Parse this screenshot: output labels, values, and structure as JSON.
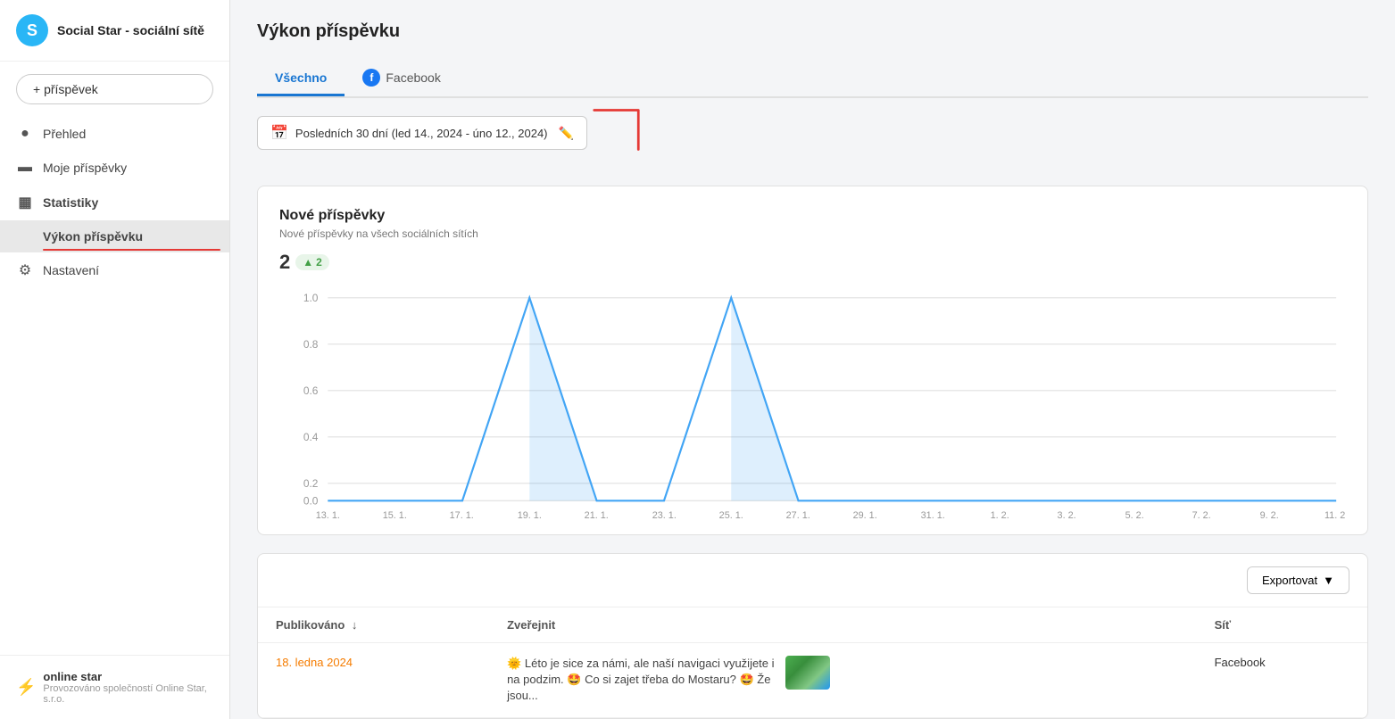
{
  "sidebar": {
    "logo_letter": "S",
    "title": "Social Star - sociální sítě",
    "add_post_label": "+ příspěvek",
    "nav_items": [
      {
        "id": "prehled",
        "label": "Přehled",
        "icon": "●"
      },
      {
        "id": "moje-prispevky",
        "label": "Moje příspěvky",
        "icon": "▬"
      },
      {
        "id": "statistiky",
        "label": "Statistiky",
        "icon": "▦",
        "expanded": true
      },
      {
        "id": "vykon-prispevku",
        "label": "Výkon příspěvku",
        "sub": true
      },
      {
        "id": "nastaveni",
        "label": "Nastavení",
        "icon": "⚙"
      }
    ],
    "footer": {
      "brand_icon": "⚡",
      "brand_name": "online star",
      "powered_by": "Provozováno společností Online Star, s.r.o."
    }
  },
  "page": {
    "title": "Výkon příspěvku",
    "tabs": [
      {
        "id": "vsechno",
        "label": "Všechno",
        "active": true
      },
      {
        "id": "facebook",
        "label": "Facebook",
        "active": false,
        "has_icon": true
      }
    ],
    "date_filter": {
      "label": "Posledních 30 dní (led 14., 2024 - úno 12., 2024)"
    },
    "chart": {
      "title": "Nové příspěvky",
      "subtitle": "Nové příspěvky na všech sociálních sítích",
      "stat_value": "2",
      "stat_badge": "▲ 2",
      "x_labels": [
        "13. 1.",
        "15. 1.",
        "17. 1.",
        "19. 1.",
        "21. 1.",
        "23. 1.",
        "25. 1.",
        "27. 1.",
        "29. 1.",
        "31. 1.",
        "1. 2.",
        "3. 2.",
        "5. 2.",
        "7. 2.",
        "9. 2.",
        "11. 2."
      ],
      "y_labels": [
        "0.0",
        "0.2",
        "0.4",
        "0.6",
        "0.8",
        "1.0"
      ],
      "peaks": [
        {
          "x_index": 3,
          "value": 1.0
        },
        {
          "x_index": 6,
          "value": 1.0
        }
      ]
    },
    "table": {
      "export_label": "Exportovat",
      "columns": [
        "Publikováno",
        "Zveřejnit",
        "Síť"
      ],
      "rows": [
        {
          "date": "18. ledna 2024",
          "text": "🌞 Léto je sice za námi, ale naší navigaci využijete i na podzim. 🤩 Co si zajet třeba do Mostaru? 🤩 Že jsou...",
          "network": "Facebook"
        }
      ]
    }
  }
}
